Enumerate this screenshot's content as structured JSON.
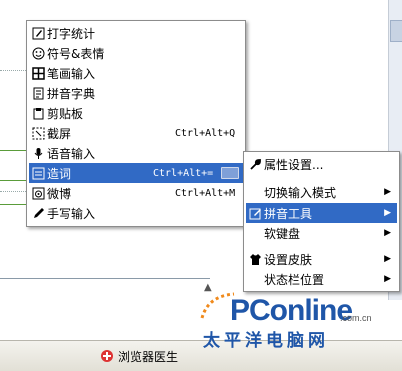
{
  "main_menu": {
    "items": [
      {
        "label": "打字统计",
        "icon": "edit-icon"
      },
      {
        "label": "符号&表情",
        "icon": "smiley-icon"
      },
      {
        "label": "笔画输入",
        "icon": "grid-icon"
      },
      {
        "label": "拼音字典",
        "icon": "dictionary-icon"
      },
      {
        "label": "剪贴板",
        "icon": "clipboard-icon"
      },
      {
        "label": "截屏",
        "icon": "screenshot-icon",
        "shortcut": "Ctrl+Alt+Q"
      },
      {
        "label": "语音输入",
        "icon": "microphone-icon"
      },
      {
        "label": "造词",
        "icon": "make-word-icon",
        "shortcut": "Ctrl+Alt+=",
        "selected": true
      },
      {
        "label": "微博",
        "icon": "weibo-icon",
        "shortcut": "Ctrl+Alt+M"
      },
      {
        "label": "手写输入",
        "icon": "pen-icon"
      }
    ]
  },
  "sub_menu": {
    "items": [
      {
        "label": "属性设置...",
        "icon": "wrench-icon"
      },
      {
        "label": "切换输入模式",
        "has_submenu": true
      },
      {
        "label": "拼音工具",
        "icon": "pinyin-tool-icon",
        "has_submenu": true,
        "selected": true
      },
      {
        "label": "软键盘",
        "has_submenu": true
      },
      {
        "label": "设置皮肤",
        "icon": "shirt-icon",
        "has_submenu": true
      },
      {
        "label": "状态栏位置",
        "has_submenu": true
      }
    ]
  },
  "taskbar": {
    "item_label": "浏览器医生"
  },
  "watermark": {
    "brand": "PConline",
    "domain": ".com.cn",
    "chinese": "太平洋电脑网"
  },
  "colors": {
    "selection": "#316ac5",
    "logo": "#1f56a8"
  }
}
